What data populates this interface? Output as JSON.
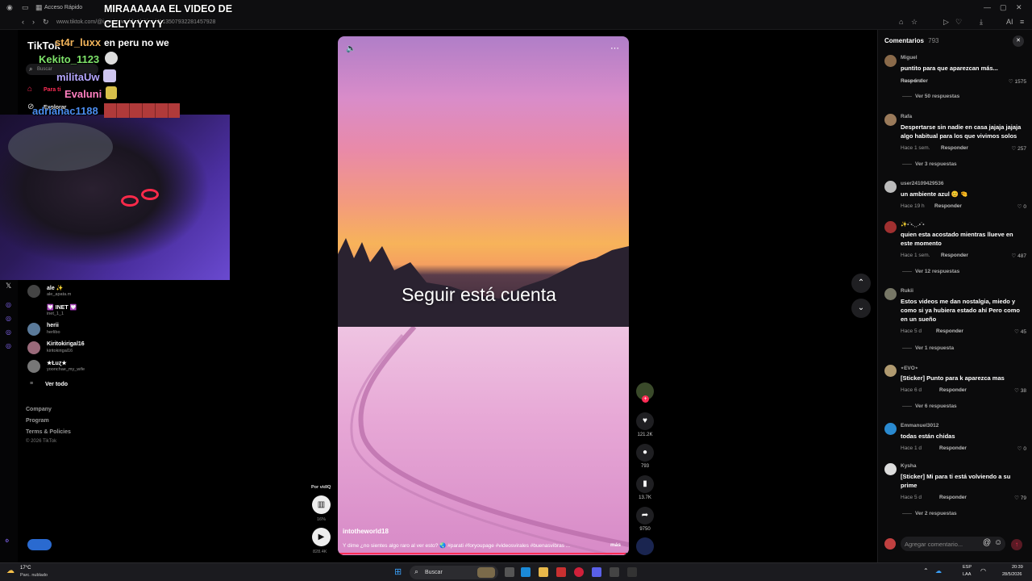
{
  "browser": {
    "tab_label": "Acceso Rápido",
    "url": "www.tiktok.com/@intotheworld18/video/7613507932281457928"
  },
  "overlay_chat": {
    "headline_line1": "MIRAAAAAA EL VIDEO DE",
    "headline_line2": "CELYYYYYY",
    "messages": [
      {
        "name": "st4r_luxx",
        "text": "en peru no we",
        "color": "#f0b35a"
      },
      {
        "name": "Kekito_1123",
        "text": "",
        "color": "#7ee36a"
      },
      {
        "name": "militaUw",
        "text": "",
        "color": "#b6a7ff"
      },
      {
        "name": "Evaluni",
        "text": "",
        "color": "#ff7fc0"
      },
      {
        "name": "adrianac1188",
        "text": "",
        "color": "#4b8df0"
      }
    ]
  },
  "sidebar": {
    "logo": "TikTok",
    "search_placeholder": "Buscar",
    "nav": [
      {
        "label": "Para ti",
        "icon": "home-icon"
      },
      {
        "label": "Explorar",
        "icon": "compass-icon"
      }
    ],
    "following": [
      {
        "name": "ale ✨",
        "handle": "ale_apata.m"
      },
      {
        "name": "💟 INET 💟",
        "handle": "inet_1_1"
      },
      {
        "name": "herii",
        "handle": "herlibo"
      },
      {
        "name": "Kiritokirigal16",
        "handle": "kiritokirigal16"
      },
      {
        "name": "★Łuɀ★",
        "handle": "yoonchae_my_wife"
      }
    ],
    "see_all": "Ver todo",
    "footer": [
      "Company",
      "Program",
      "Terms & Policies"
    ],
    "copyright": "© 2026 TikTok"
  },
  "video": {
    "overlay_text": "Seguir está cuenta",
    "author": "intotheworld18",
    "caption": "Y dime ¿no sientes algo raro al ver esto? 🌏 #parati #foryoupage #videosvirales #buenasvibras ...",
    "more": "más",
    "progress": 0.99
  },
  "actions": {
    "likes": "121.2K",
    "comments": "793",
    "saves": "13.7K",
    "shares": "9750"
  },
  "left_controls": {
    "label": "Por vidIQ",
    "percent": "16%",
    "views": "828.4K"
  },
  "comments_panel": {
    "title": "Comentarios",
    "count": "793",
    "reply_label": "Responder",
    "input_placeholder": "Agregar comentario...",
    "items": [
      {
        "user": "Miguel",
        "text": "puntito para que aparezcan más...",
        "time": "Hace 6 d",
        "likes": "1575",
        "more": "Ver 50 respuestas",
        "av": "#8a6a4a"
      },
      {
        "user": "Rafa",
        "text": "Despertarse sin nadie en casa jajaja jajaja algo habitual para los que vivimos solos",
        "time": "Hace 1 sem.",
        "likes": "257",
        "more": "Ver 3 respuestas",
        "av": "#9a7a5a"
      },
      {
        "user": "user24109429536",
        "text": "un ambiente azul 😊 🤏",
        "time": "Hace 19 h",
        "likes": "0",
        "more": "",
        "av": "#bbbbbb"
      },
      {
        "user": "✨•¨•.¸¸.•¨•",
        "text": "quien esta acostado mientras llueve en este momento",
        "time": "Hace 1 sem.",
        "likes": "487",
        "more": "Ver 12 respuestas",
        "av": "#a03030"
      },
      {
        "user": "Rukii",
        "text": "Estos videos me dan nostalgia, miedo y como si ya hubiera estado ahí Pero como en un sueño",
        "time": "Hace 5 d",
        "likes": "45",
        "more": "Ver 1 respuesta",
        "av": "#777766"
      },
      {
        "user": "⋆EVO⋆",
        "text": "[Sticker] Punto para k aparezca mas",
        "time": "Hace 6 d",
        "likes": "38",
        "more": "Ver 6 respuestas",
        "av": "#b09a70"
      },
      {
        "user": "Emmanuel3012",
        "text": "todas están chidas",
        "time": "Hace 1 d",
        "likes": "0",
        "more": "",
        "av": "#2a8ad0"
      },
      {
        "user": "Kysha",
        "text": "[Sticker] Mi para ti está volviendo a su prime",
        "time": "Hace 5 d",
        "likes": "79",
        "more": "Ver 2 respuestas",
        "av": "#dddddd"
      }
    ]
  },
  "taskbar": {
    "weather_temp": "17°C",
    "weather_desc": "Parc. nublado",
    "search": "Buscar",
    "lang": "ESP",
    "lang2": "LAA",
    "time": "20:39",
    "date": "28/5/2026"
  }
}
